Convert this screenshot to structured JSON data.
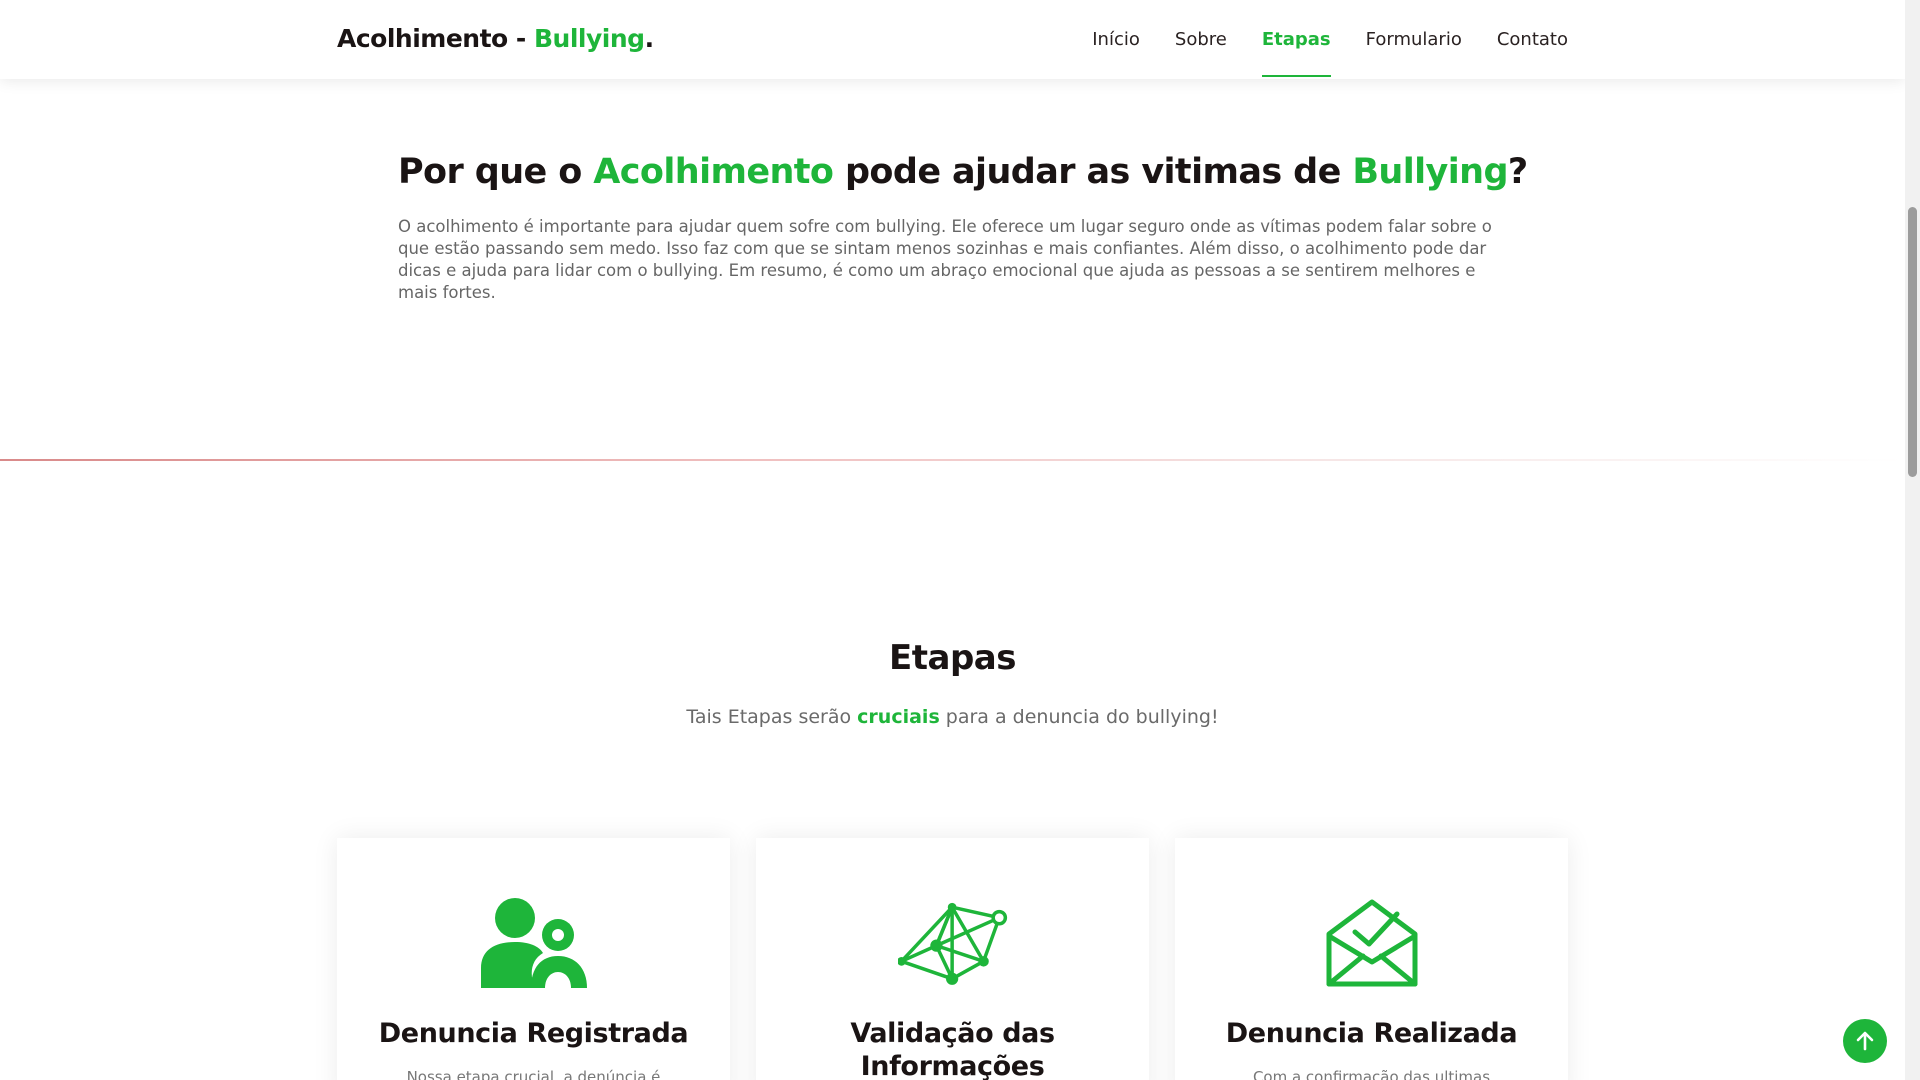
{
  "brand": {
    "name_main": "Acolhimento - ",
    "name_accent": "Bullying",
    "name_dot": "."
  },
  "nav": {
    "items": [
      {
        "label": "Início"
      },
      {
        "label": "Sobre"
      },
      {
        "label": "Etapas"
      },
      {
        "label": "Formulario"
      },
      {
        "label": "Contato"
      }
    ],
    "active": "Etapas"
  },
  "about": {
    "title_part1": "Por que o ",
    "title_accent1": "Acolhimento",
    "title_part2": " pode ajudar as vitimas de ",
    "title_accent2": "Bullying",
    "title_part3": "?",
    "text": "O acolhimento é importante para ajudar quem sofre com bullying. Ele oferece um lugar seguro onde as vítimas podem falar sobre o que estão passando sem medo. Isso faz com que se sintam menos sozinhas e mais confiantes. Além disso, o acolhimento pode dar dicas e ajuda para lidar com o bullying. Em resumo, é como um abraço emocional que ajuda as pessoas a se sentirem melhores e mais fortes."
  },
  "etapas": {
    "title": "Etapas",
    "subtitle_part1": "Tais Etapas serão ",
    "subtitle_accent": "cruciais",
    "subtitle_part2": " para a denuncia do bullying!",
    "cards": [
      {
        "icon": "people-icon",
        "title": "Denuncia Registrada",
        "text": "Nossa etapa crucial, a denúncia é"
      },
      {
        "icon": "network-icon",
        "title": "Validação das Informações",
        "text": ""
      },
      {
        "icon": "envelope-check-icon",
        "title": "Denuncia Realizada",
        "text": "Com a confirmação das ultimas"
      }
    ]
  },
  "colors": {
    "accent": "#1eb53a",
    "text_dark": "#1a1414",
    "text_muted": "#666666"
  },
  "back_to_top": {
    "icon": "arrow-up-icon"
  }
}
